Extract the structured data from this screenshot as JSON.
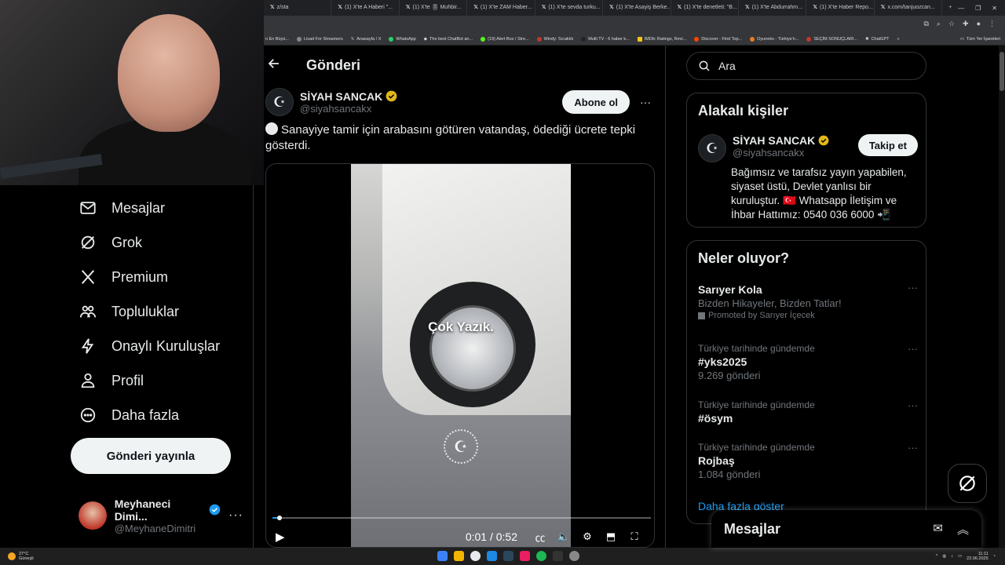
{
  "browser": {
    "tabs": [
      "z/sta",
      "(1) X'te A Haberi \"...",
      "(1) X'te 🎚 Muhbir...",
      "(1) X'te ZAM Haber...",
      "(1) X'te sevda turku...",
      "(1) X'te Asayiş Berke...",
      "(1) X'te denetleti: \"B...",
      "(1) X'te Abdurrahm...",
      "(1) X'te Haber Repo...",
      "x.com/tanjuozcan..."
    ],
    "new_tab": "+",
    "bookmarks": [
      "n En Büyü...",
      "Livad For Streamers",
      "Anasayfa / X",
      "WhatsApp",
      "The best ChatBot an...",
      "(19) Alert Box / Stre...",
      "Windy: Sıcaklık",
      "Multi TV - 6 haber k...",
      "IMDb: Ratings, Revi...",
      "Discover - Find Top...",
      "Oyuneks - Türkiye'n...",
      "SEÇİM SONUÇLARI...",
      "ChatGPT",
      "»"
    ],
    "all_bookmarks": "Tüm Yer İşaretleri"
  },
  "leftnav": {
    "items": [
      {
        "label": "Mesajlar",
        "icon": "mail-icon"
      },
      {
        "label": "Grok",
        "icon": "grok-icon"
      },
      {
        "label": "Premium",
        "icon": "x-logo-icon"
      },
      {
        "label": "Topluluklar",
        "icon": "communities-icon"
      },
      {
        "label": "Onaylı Kuruluşlar",
        "icon": "lightning-icon"
      },
      {
        "label": "Profil",
        "icon": "person-icon"
      },
      {
        "label": "Daha fazla",
        "icon": "more-circle-icon"
      }
    ],
    "post_button": "Gönderi yayınla",
    "account": {
      "name": "Meyhaneci Dimi...",
      "handle": "@MeyhaneDimitri",
      "more": "···"
    }
  },
  "post": {
    "header_title": "Gönderi",
    "author_name": "SİYAH SANCAK",
    "author_handle": "@siyahsancakx",
    "subscribe_label": "Abone ol",
    "more": "···",
    "text": "Sanayiye tamir için arabasını götüren vatandaş, ödediği ücrete tepki gösterdi.",
    "video": {
      "caption": "Çok Yazık.",
      "time": "0:01 / 0:52",
      "progress": 0.019
    }
  },
  "right": {
    "search_placeholder": "Ara",
    "related_title": "Alakalı kişiler",
    "related": {
      "name": "SİYAH SANCAK",
      "handle": "@siyahsancakx",
      "follow_label": "Takip et",
      "bio": "Bağımsız ve tarafsız yayın yapabilen, siyaset üstü, Devlet yanlısı bir kuruluştur. 🇹🇷 Whatsapp İletişim ve İhbar Hattımız: 0540 036 6000 📲"
    },
    "trends_title": "Neler oluyor?",
    "trends": [
      {
        "small": "",
        "main": "Sarıyer Kola",
        "sub": "Bizden Hikayeler, Bizden Tatlar!",
        "promo": "Promoted by Sarıyer İçecek"
      },
      {
        "small": "Türkiye tarihinde gündemde",
        "main": "#yks2025",
        "sub": "9.269 gönderi",
        "promo": ""
      },
      {
        "small": "Türkiye tarihinde gündemde",
        "main": "#ösym",
        "sub": "",
        "promo": ""
      },
      {
        "small": "Türkiye tarihinde gündemde",
        "main": "Rojbaş",
        "sub": "1.084 gönderi",
        "promo": ""
      }
    ],
    "trend_more": "···",
    "show_more": "Daha fazla göster"
  },
  "messages_drawer": {
    "title": "Mesajlar"
  },
  "taskbar": {
    "weather_temp": "27°C",
    "weather_text": "Güneşli",
    "time": "11:11",
    "date": "22.06.2025"
  },
  "colors": {
    "background": "#000000",
    "text": "#e7e9ea",
    "muted": "#71767b",
    "accent": "#1d9bf0",
    "border": "#2f3336",
    "verified_gold": "#e2b719",
    "verified_blue": "#1d9bf0"
  }
}
